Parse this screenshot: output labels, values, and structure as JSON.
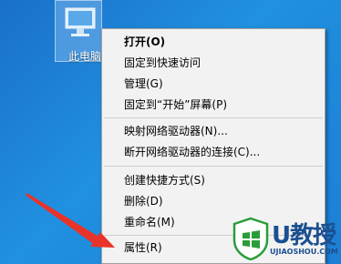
{
  "desktop": {
    "icon_label": "此电脑"
  },
  "context_menu": {
    "items": [
      {
        "label": "打开(O)",
        "bold": true
      },
      {
        "label": "固定到快速访问"
      },
      {
        "label": "管理(G)"
      },
      {
        "label": "固定到“开始”屏幕(P)"
      },
      {
        "label": "映射网络驱动器(N)..."
      },
      {
        "label": "断开网络驱动器的连接(C)..."
      },
      {
        "label": "创建快捷方式(S)"
      },
      {
        "label": "删除(D)"
      },
      {
        "label": "重命名(M)"
      },
      {
        "label": "属性(R)"
      }
    ]
  },
  "watermark": {
    "brand": "U教授",
    "url": "UJIAOSHOU.COM"
  },
  "colors": {
    "desktop_blue": "#1f7fd3",
    "menu_bg": "#f2f2f2",
    "arrow_red": "#e8332a",
    "logo_green": "#2a9d3a"
  }
}
